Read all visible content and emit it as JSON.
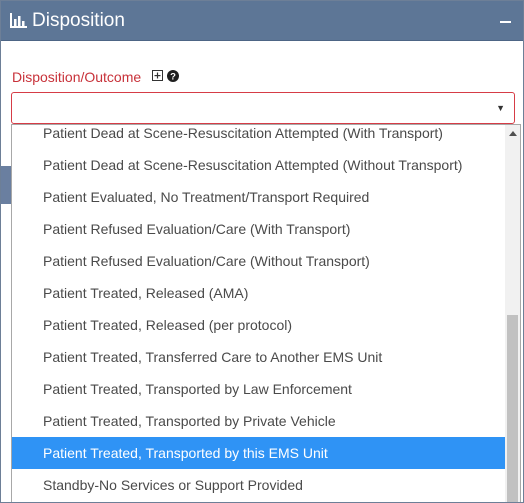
{
  "panel": {
    "title": "Disposition",
    "title_icon": "bar-chart-icon",
    "collapse_icon": "minus-icon"
  },
  "field": {
    "label": "Disposition/Outcome",
    "add_icon": "plus-square-icon",
    "help_icon": "question-circle-icon",
    "selected_value": "",
    "caret_glyph": "▼"
  },
  "dropdown": {
    "options": [
      "Patient Dead at Scene-Resuscitation Attempted (With Transport)",
      "Patient Dead at Scene-Resuscitation Attempted (Without Transport)",
      "Patient Evaluated, No Treatment/Transport Required",
      "Patient Refused Evaluation/Care (With Transport)",
      "Patient Refused Evaluation/Care (Without Transport)",
      "Patient Treated, Released (AMA)",
      "Patient Treated, Released (per protocol)",
      "Patient Treated, Transferred Care to Another EMS Unit",
      "Patient Treated, Transported by Law Enforcement",
      "Patient Treated, Transported by Private Vehicle",
      "Patient Treated, Transported by this EMS Unit",
      "Standby-No Services or Support Provided"
    ],
    "highlighted_option": "Patient Treated, Transported by this EMS Unit"
  },
  "colors": {
    "header_bg": "#5d7696",
    "label_red": "#c8323a",
    "highlight_blue": "#2f93f5"
  }
}
